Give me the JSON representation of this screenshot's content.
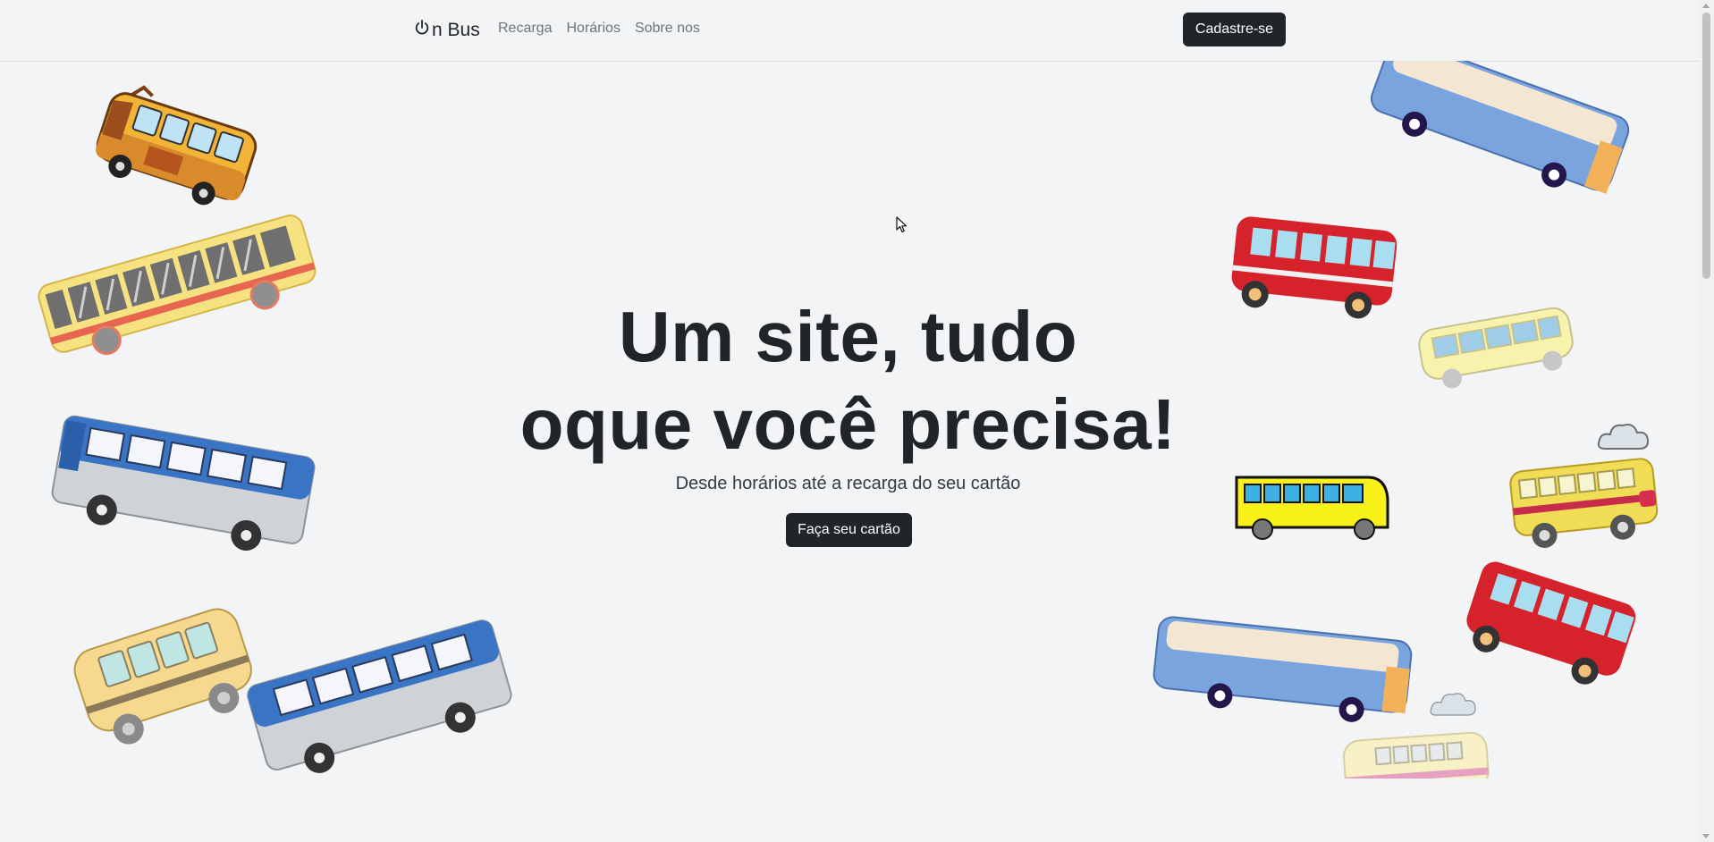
{
  "navbar": {
    "brand_icon": "power-icon",
    "brand_text": "n Bus",
    "links": [
      "Recarga",
      "Horários",
      "Sobre nos"
    ],
    "signup_label": "Cadastre-se"
  },
  "hero": {
    "title_line1": "Um site, tudo",
    "title_line2": "oque você precisa!",
    "subtitle": "Desde horários  até a recarga do seu cartão",
    "cta_label": "Faça seu cartão"
  },
  "colors": {
    "primary_dark": "#212529",
    "background": "#f3f4f5",
    "nav_link": "#6c757d"
  },
  "decorations": {
    "bus_icons": [
      "school-bus-icon",
      "coach-bus-icon",
      "double-decker-bus-icon",
      "city-bus-icon",
      "cloud-icon"
    ]
  }
}
